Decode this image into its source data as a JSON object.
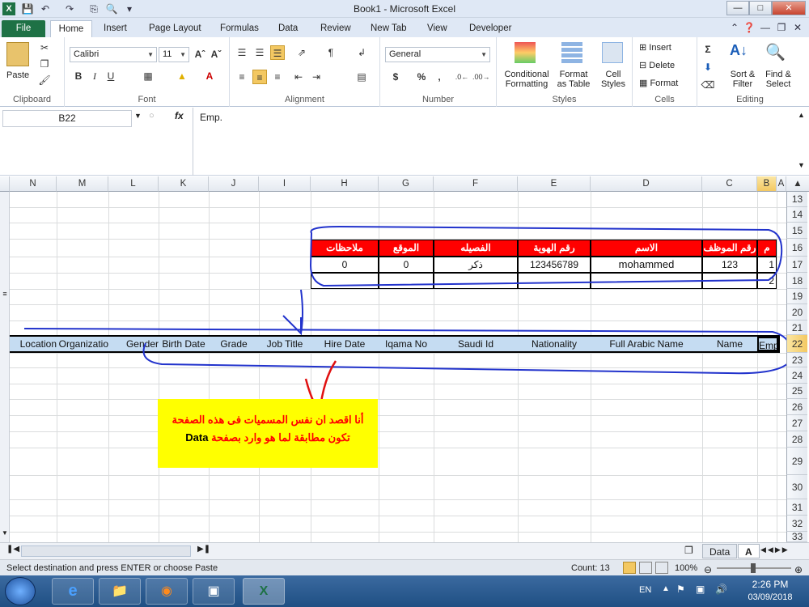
{
  "window": {
    "title": "Book1 - Microsoft Excel"
  },
  "qat": {
    "save_icon": "save-icon",
    "undo_icon": "undo-icon",
    "redo_icon": "redo-icon"
  },
  "tabs": [
    "File",
    "Home",
    "Insert",
    "Page Layout",
    "Formulas",
    "Data",
    "Review",
    "New Tab",
    "View",
    "Developer"
  ],
  "ribbon": {
    "clipboard": {
      "paste": "Paste",
      "label": "Clipboard"
    },
    "font": {
      "name": "Calibri",
      "size": "11",
      "bold": "B",
      "italic": "I",
      "underline": "U",
      "label": "Font"
    },
    "alignment": {
      "label": "Alignment"
    },
    "number": {
      "format": "General",
      "currency": "$",
      "percent": "%",
      "comma": ",",
      "label": "Number"
    },
    "styles": {
      "conditional": "Conditional",
      "formatting": "Formatting",
      "format": "Format",
      "as_table": "as Table",
      "cell": "Cell",
      "cell_styles": "Styles",
      "label": "Styles"
    },
    "cells": {
      "insert": "Insert",
      "delete": "Delete",
      "format": "Format",
      "label": "Cells"
    },
    "editing": {
      "sigma": "Σ",
      "sort": "Sort &",
      "filter": "Filter",
      "find": "Find &",
      "select": "Select",
      "label": "Editing"
    }
  },
  "namebox": "B22",
  "fx": "fx",
  "formula": "Emp.",
  "columns": [
    "N",
    "M",
    "L",
    "K",
    "J",
    "I",
    "H",
    "G",
    "F",
    "E",
    "D",
    "C",
    "B",
    "A"
  ],
  "rows": [
    "13",
    "14",
    "15",
    "16",
    "17",
    "18",
    "19",
    "20",
    "21",
    "22",
    "23",
    "24",
    "25",
    "26",
    "27",
    "28",
    "29",
    "30",
    "31",
    "32",
    "33"
  ],
  "table1": {
    "headers": [
      "ملاحظات",
      "الموقع",
      "الفصيله",
      "رقم الهوية",
      "الاسم",
      "رقم الموظف",
      "م"
    ],
    "row1": [
      "0",
      "0",
      "ذكر",
      "123456789",
      "mohammed",
      "123",
      "1"
    ],
    "row2": [
      "",
      "",
      "",
      "",
      "",
      "",
      "2"
    ]
  },
  "row22": [
    "Location",
    "Organizatio",
    "Gender",
    "Birth Date",
    "Grade",
    "Job Title",
    "Hire Date",
    "Iqama No",
    "Saudi Id",
    "Nationality",
    "Full Arabic Name",
    "Name",
    "Emp."
  ],
  "note": {
    "line1": "أنا اقصد ان نفس المسميات فى هذه الصفحة",
    "line2": "تكون مطابقة لما هو وارد بصفحة",
    "en": "Data"
  },
  "sheets": [
    "Data",
    "A"
  ],
  "status": {
    "left": "Select destination and press ENTER or choose Paste",
    "count": "Count: 13",
    "zoom": "100%"
  },
  "taskbar": {
    "lang": "EN",
    "time": "2:26 PM",
    "date": "03/09/2018"
  }
}
